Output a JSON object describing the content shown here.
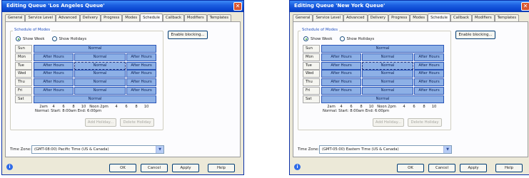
{
  "tabs": [
    "General",
    "Service Level",
    "Advanced",
    "Delivery",
    "Progress",
    "Modes",
    "Schedule",
    "Callback",
    "Modifiers",
    "Templates"
  ],
  "active_tab": "Schedule",
  "group_label": "Schedule of Modes",
  "show_week_label": "Show Week",
  "show_holidays_label": "Show Holidays",
  "enable_blocking_label": "Enable blocking...",
  "days": [
    "Sun",
    "Mon",
    "Tue",
    "Wed",
    "Thu",
    "Fri",
    "Sat"
  ],
  "seg_labels": {
    "normal": "Normal",
    "after_hours": "After Hours"
  },
  "axis_ticks": [
    "2am",
    "4",
    "6",
    "8",
    "10",
    "Noon",
    "2pm",
    "4",
    "6",
    "8",
    "10"
  ],
  "normal_info": "Normal: Start: 8:00am End: 6:00pm",
  "add_holiday_label": "Add Holiday...",
  "delete_holiday_label": "Delete Holiday",
  "time_zone_label": "Time Zone:",
  "buttons": {
    "ok": "OK",
    "cancel": "Cancel",
    "apply": "Apply",
    "help": "Help"
  },
  "dialogs": [
    {
      "title": "Editing Queue 'Los Angeles Queue'",
      "time_zone": "(GMT-08:00) Pacific Time (US & Canada)"
    },
    {
      "title": "Editing Queue 'New York Queue'",
      "time_zone": "(GMT-05:00) Eastern Time (US & Canada)"
    }
  ],
  "colors": {
    "title_bar": "#0a46d0",
    "segment_fill": "#8db0e6",
    "dialog_bg": "#ece9d8"
  }
}
